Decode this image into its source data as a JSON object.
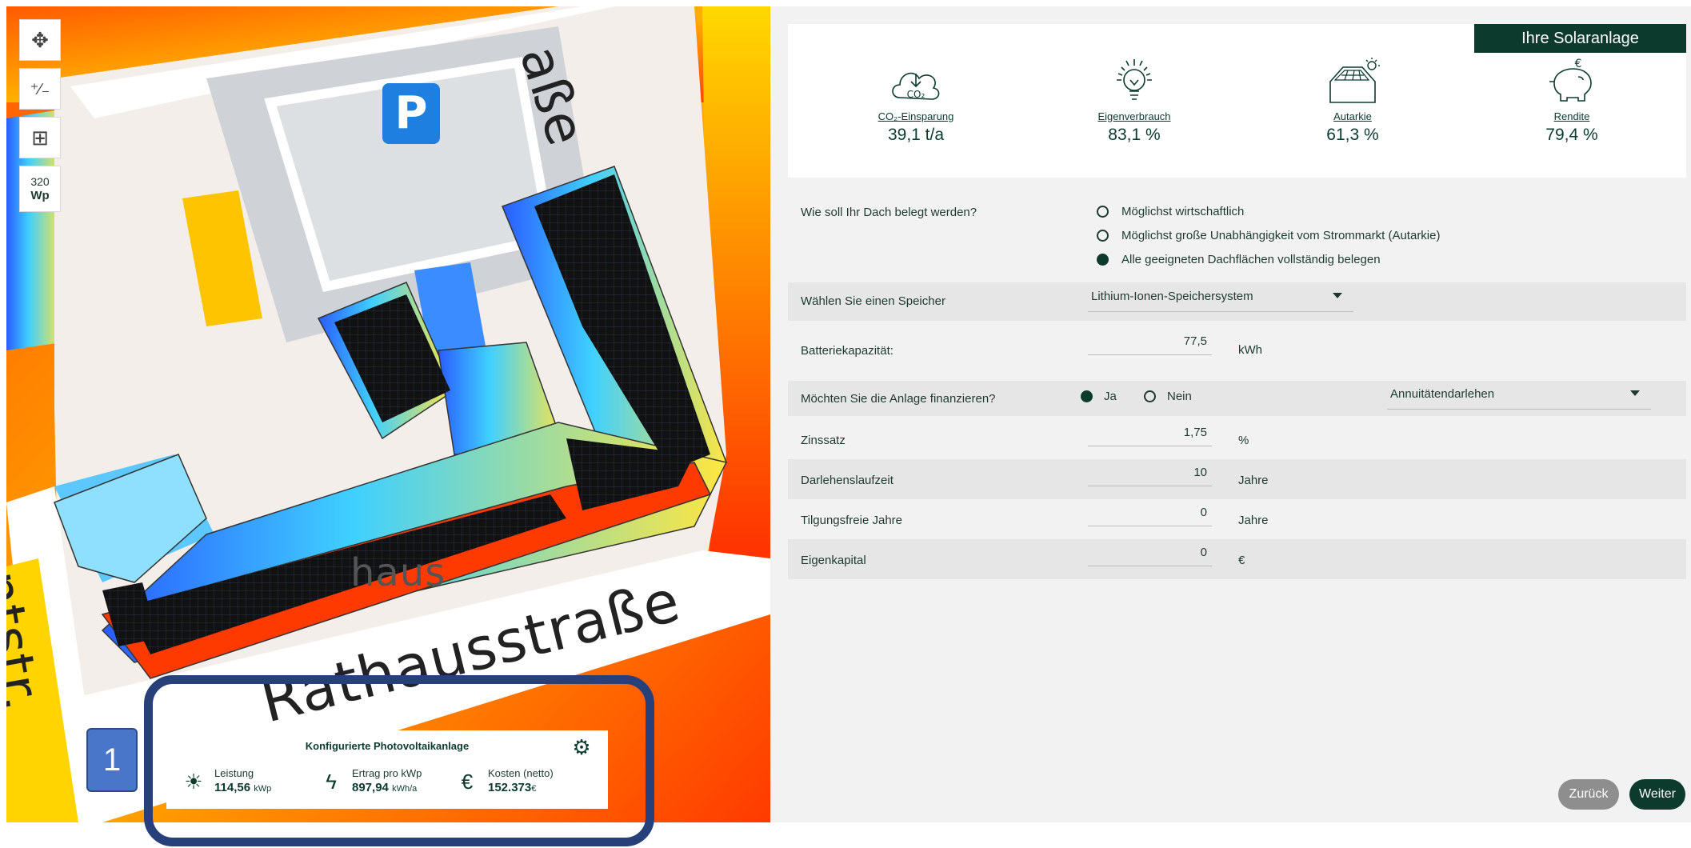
{
  "map": {
    "tools": [
      {
        "icon": "move-icon",
        "glyph": "✥"
      },
      {
        "icon": "plus-minus-icon",
        "glyph": "⁺∕₋"
      },
      {
        "icon": "panel-grid-icon",
        "glyph": "⊞"
      }
    ],
    "wp_badge": {
      "value": "320",
      "unit": "Wp"
    },
    "streets": {
      "top": "aße",
      "main": "Rathausstraße",
      "left": "ntstr.",
      "building": "haus"
    }
  },
  "annotation": {
    "number": "1"
  },
  "pv_summary": {
    "title": "Konfigurierte Photovoltaikanlage",
    "stats": [
      {
        "icon": "sun-icon",
        "label": "Leistung",
        "value": "114,56",
        "unit": "kWp"
      },
      {
        "icon": "lightning-icon",
        "label": "Ertrag pro kWp",
        "value": "897,94",
        "unit": "kWh/a"
      },
      {
        "icon": "euro-icon",
        "label": "Kosten (netto)",
        "value": "152.373",
        "unit": "€"
      }
    ]
  },
  "kpi": {
    "header": "Ihre Solaranlage",
    "items": [
      {
        "icon": "co2-cloud-icon",
        "label": "CO₂-Einsparung",
        "value": "39,1 t/a"
      },
      {
        "icon": "lightbulb-icon",
        "label": "Eigenverbrauch",
        "value": "83,1 %"
      },
      {
        "icon": "solar-house-icon",
        "label": "Autarkie",
        "value": "61,3 %"
      },
      {
        "icon": "piggy-bank-icon",
        "label": "Rendite",
        "value": "79,4 %"
      }
    ]
  },
  "form": {
    "roof_question": "Wie soll Ihr Dach belegt werden?",
    "roof_options": [
      {
        "label": "Möglichst wirtschaftlich",
        "selected": false
      },
      {
        "label": "Möglichst große Unabhängigkeit vom Strommarkt (Autarkie)",
        "selected": false
      },
      {
        "label": "Alle geeigneten Dachflächen vollständig belegen",
        "selected": true
      }
    ],
    "storage_label": "Wählen Sie einen Speicher",
    "storage_value": "Lithium-Ionen-Speichersystem",
    "battery_label": "Batteriekapazität:",
    "battery_value": "77,5",
    "battery_unit": "kWh",
    "finance_label": "Möchten Sie die Anlage finanzieren?",
    "finance_yes": "Ja",
    "finance_no": "Nein",
    "finance_selected": "Ja",
    "loan_type": "Annuitätendarlehen",
    "interest_label": "Zinssatz",
    "interest_value": "1,75",
    "interest_unit": "%",
    "term_label": "Darlehenslaufzeit",
    "term_value": "10",
    "term_unit": "Jahre",
    "grace_label": "Tilgungsfreie Jahre",
    "grace_value": "0",
    "grace_unit": "Jahre",
    "equity_label": "Eigenkapital",
    "equity_value": "0",
    "equity_unit": "€"
  },
  "nav": {
    "back": "Zurück",
    "next": "Weiter"
  },
  "colors": {
    "brand": "#0c3b2e",
    "annotation": "#27407a",
    "badge": "#4a76c9"
  }
}
